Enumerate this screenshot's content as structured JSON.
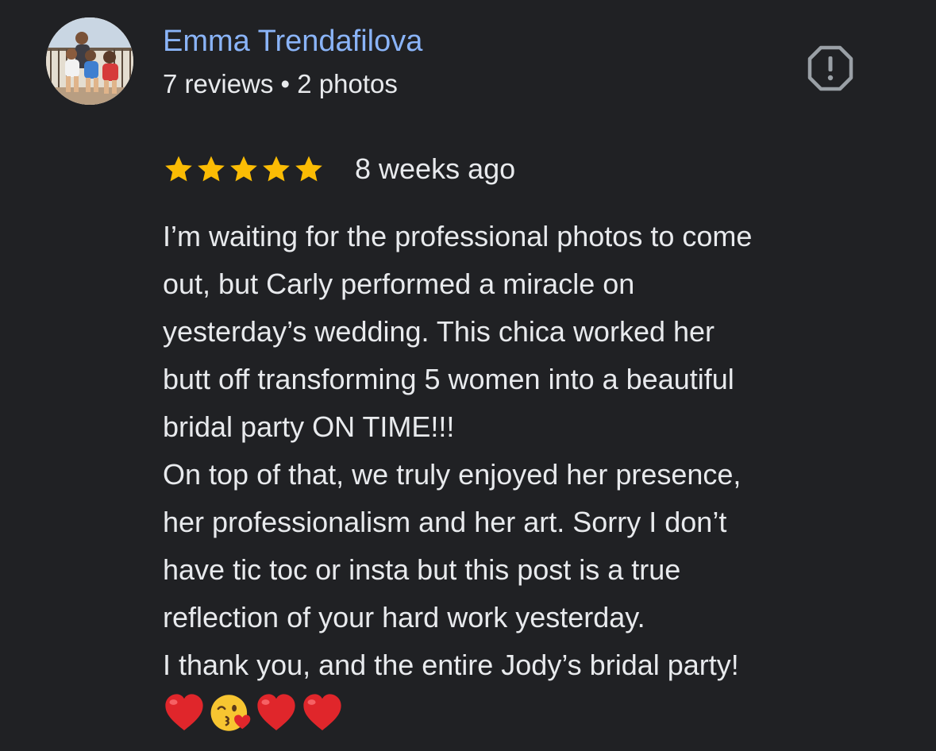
{
  "author": {
    "name": "Emma Trendafilova",
    "meta": "7 reviews • 2 photos"
  },
  "review": {
    "rating": 5,
    "rating_max": 5,
    "time_ago": "8 weeks ago",
    "lines": [
      "I’m waiting for the professional photos to come",
      "out, but Carly performed a miracle on",
      "yesterday’s wedding. This chica worked her",
      "butt off transforming 5 women into a beautiful",
      "bridal party ON TIME!!!",
      "On top of that, we truly enjoyed her presence,",
      "her professionalism and her art. Sorry I don’t",
      "have tic toc or insta but this post is a true",
      "reflection of your hard work yesterday.",
      "I thank you, and the entire Jody’s bridal party!"
    ],
    "emojis": [
      "red-heart",
      "face-blowing-kiss",
      "red-heart",
      "red-heart"
    ]
  },
  "icons": {
    "report": "report-flag-octagon-icon",
    "star": "star-icon"
  },
  "colors": {
    "background": "#202124",
    "author_name": "#8ab4f8",
    "text": "#e8eaed",
    "star": "#fbbc04",
    "report_icon": "#9aa0a6"
  }
}
